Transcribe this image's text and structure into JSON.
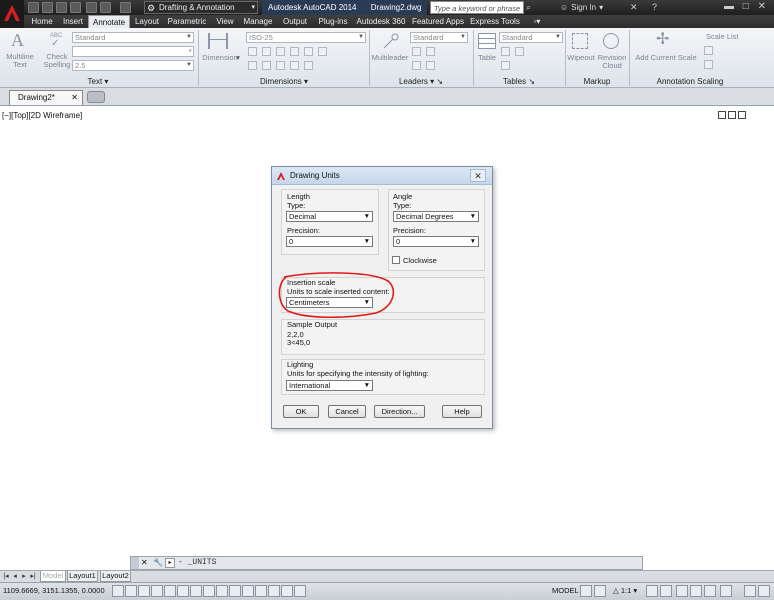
{
  "titlebar": {
    "workspace": "Drafting & Annotation",
    "app_title": "Autodesk AutoCAD 2014",
    "file_name": "Drawing2.dwg",
    "search_placeholder": "Type a keyword or phrase",
    "signin": "Sign In"
  },
  "ribbon_tabs": [
    {
      "label": "Home"
    },
    {
      "label": "Insert"
    },
    {
      "label": "Annotate",
      "active": true
    },
    {
      "label": "Layout"
    },
    {
      "label": "Parametric"
    },
    {
      "label": "View"
    },
    {
      "label": "Manage"
    },
    {
      "label": "Output"
    },
    {
      "label": "Plug-ins"
    },
    {
      "label": "Autodesk 360"
    },
    {
      "label": "Featured Apps"
    },
    {
      "label": "Express Tools"
    }
  ],
  "ribbon": {
    "text_panel": {
      "label": "Text",
      "multiline_text": "Multiline\nText",
      "check_spelling": "Check\nSpelling",
      "abc": "ABC",
      "style_value": "Standard",
      "height_value": "2.5"
    },
    "dimensions_panel": {
      "label": "Dimensions",
      "dimension_button": "Dimension",
      "style_value": "ISO-25"
    },
    "leaders_panel": {
      "label": "Leaders",
      "multileader_button": "Multileader",
      "style_value": "Standard"
    },
    "tables_panel": {
      "label": "Tables",
      "table_button": "Table",
      "style_value": "Standard"
    },
    "markup_panel": {
      "label": "Markup",
      "wipeout_button": "Wipeout",
      "revision_cloud_button": "Revision\nCloud"
    },
    "annotation_scaling_panel": {
      "label": "Annotation Scaling",
      "add_current_scale": "Add Current Scale",
      "scale_list": "Scale List"
    }
  },
  "doc_tab": {
    "label": "Drawing2*"
  },
  "viewport_label": "[−][Top][2D Wireframe]",
  "dialog": {
    "title": "Drawing Units",
    "length": {
      "heading": "Length",
      "type_label": "Type:",
      "type_value": "Decimal",
      "precision_label": "Precision:",
      "precision_value": "0"
    },
    "angle": {
      "heading": "Angle",
      "type_label": "Type:",
      "type_value": "Decimal Degrees",
      "precision_label": "Precision:",
      "precision_value": "0",
      "clockwise_label": "Clockwise",
      "clockwise_checked": false
    },
    "insertion_scale": {
      "heading": "Insertion scale",
      "units_label": "Units to scale inserted content:",
      "units_value": "Centimeters"
    },
    "sample_output": {
      "heading": "Sample Output",
      "line1": "2,2,0",
      "line2": "3<45,0"
    },
    "lighting": {
      "heading": "Lighting",
      "units_label": "Units for specifying the intensity of lighting:",
      "units_value": "International"
    },
    "buttons": {
      "ok": "OK",
      "cancel": "Cancel",
      "direction": "Direction...",
      "help": "Help"
    }
  },
  "command_line": {
    "text": "- _UNITS"
  },
  "layout_tabs": [
    {
      "label": "Model",
      "active": true
    },
    {
      "label": "Layout1"
    },
    {
      "label": "Layout2"
    }
  ],
  "statusbar": {
    "coordinates": "1109.6669, 3151.1355, 0.0000",
    "model_label": "MODEL",
    "annotation_scale": "1:1"
  },
  "colors": {
    "annotation_red": "#e31a1a",
    "titlebar_dark": "#2b2b2b",
    "ribbon_bg": "#e9edf1"
  }
}
